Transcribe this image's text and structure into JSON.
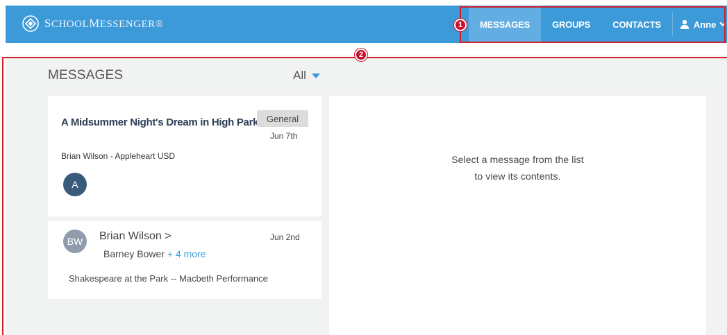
{
  "header": {
    "logo_text_first": "S",
    "logo_text_rest1": "CHOOL",
    "logo_text_M": "M",
    "logo_text_rest2": "ESSENGER",
    "logo_registered": "®",
    "nav": {
      "messages": "MESSAGES",
      "groups": "GROUPS",
      "contacts": "CONTACTS"
    },
    "user_name": "Anne"
  },
  "messages_panel": {
    "title": "MESSAGES",
    "filter_value": "All",
    "items": [
      {
        "title": "A Midsummer Night's Dream in High Park",
        "category": "General",
        "date": "Jun 7th",
        "sender": "Brian Wilson - Appleheart USD",
        "avatar_initials": "A"
      },
      {
        "avatar_initials": "BW",
        "from": "Brian Wilson >",
        "to": "Barney Bower",
        "more": "+ 4 more",
        "date": "Jun 2nd",
        "subject": "Shakespeare at the Park -- Macbeth Performance"
      }
    ]
  },
  "detail": {
    "empty_line1": "Select a message from the list",
    "empty_line2": "to view its contents."
  },
  "annotations": {
    "badge1": "1",
    "badge2": "2"
  },
  "colors": {
    "topbar": "#3d9ad9",
    "active_tab": "#62ade2",
    "annotation": "#d21f2a",
    "avatar_dark": "#3a5a7b",
    "link": "#3d9ad9"
  }
}
